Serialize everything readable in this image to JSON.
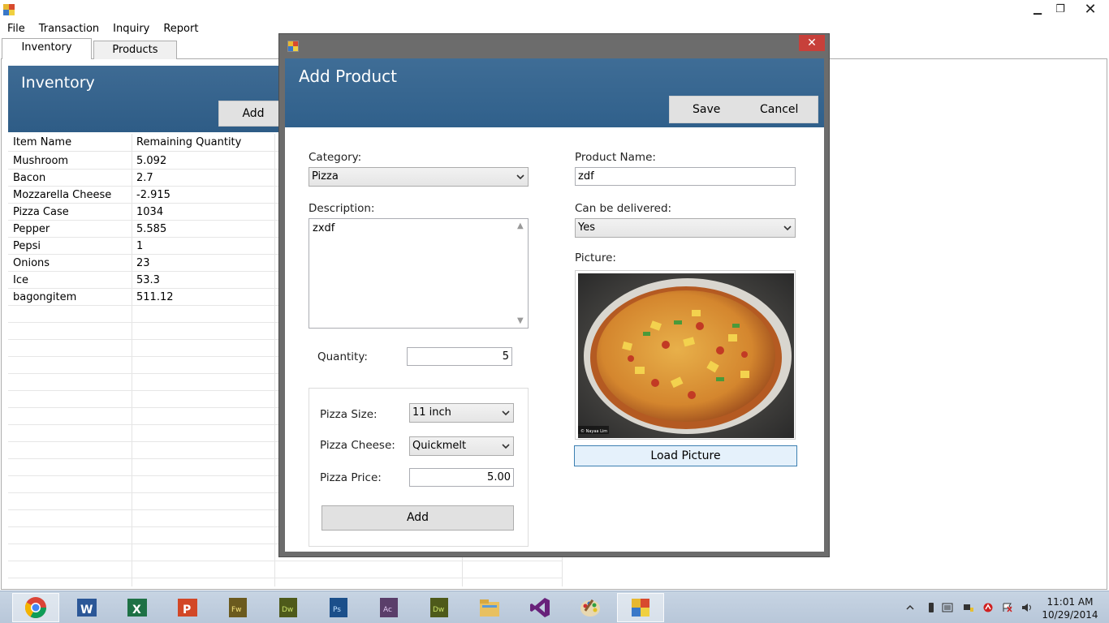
{
  "menu": [
    "File",
    "Transaction",
    "Inquiry",
    "Report"
  ],
  "tabs": [
    "Inventory",
    "Products"
  ],
  "inventory": {
    "title": "Inventory",
    "add_label": "Add",
    "columns": [
      "Item Name",
      "Remaining Quantity"
    ],
    "rows": [
      [
        "Mushroom",
        "5.092"
      ],
      [
        "Bacon",
        "2.7"
      ],
      [
        "Mozzarella Cheese",
        "-2.915"
      ],
      [
        "Pizza Case",
        "1034"
      ],
      [
        "Pepper",
        "5.585"
      ],
      [
        "Pepsi",
        "1"
      ],
      [
        "Onions",
        "23"
      ],
      [
        "Ice",
        "53.3"
      ],
      [
        "bagongitem",
        "511.12"
      ]
    ]
  },
  "dialog": {
    "title": "Add Product",
    "close_glyph": "✕",
    "save_label": "Save",
    "cancel_label": "Cancel",
    "category_label": "Category:",
    "category_value": "Pizza",
    "description_label": "Description:",
    "description_value": "zxdf",
    "quantity_label": "Quantity:",
    "quantity_value": "5",
    "pizza_size_label": "Pizza Size:",
    "pizza_size_value": "11 inch",
    "pizza_cheese_label": "Pizza Cheese:",
    "pizza_cheese_value": "Quickmelt",
    "pizza_price_label": "Pizza Price:",
    "pizza_price_value": "5.00",
    "add_label": "Add",
    "product_name_label": "Product Name:",
    "product_name_value": "zdf",
    "deliver_label": "Can be delivered:",
    "deliver_value": "Yes",
    "picture_label": "Picture:",
    "picture_credit": "© Nayaa Lim",
    "load_picture_label": "Load Picture"
  },
  "window": {
    "minimize_glyph": "▁",
    "restore_glyph": "❐",
    "close_glyph": "✕"
  },
  "taskbar": {
    "apps": [
      "chrome-icon",
      "word-icon",
      "excel-icon",
      "powerpoint-icon",
      "fireworks-icon",
      "dreamweaver-icon",
      "photoshop-icon",
      "acrobat-icon",
      "dreamweaver-icon-2",
      "file-explorer-icon",
      "visual-studio-icon",
      "paint-icon",
      "app-icon"
    ],
    "time": "11:01 AM",
    "date": "10/29/2014"
  },
  "colors": {
    "header_blue": "#3e6b94",
    "close_red": "#c7403a",
    "taskbar": "#c0cfe0"
  }
}
